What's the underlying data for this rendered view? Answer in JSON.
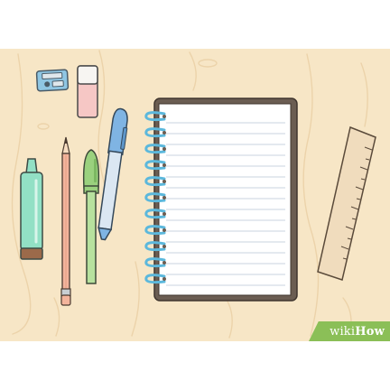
{
  "scene": {
    "description_items": [
      "pencil-sharpener",
      "eraser",
      "highlighter",
      "pencil",
      "marker",
      "pen",
      "spiral-notebook",
      "ruler"
    ],
    "colors": {
      "desk": "#f7e6c6",
      "desk_grain": "#ecd3aa",
      "page_bg": "#ffffff",
      "notebook_cover": "#6b5d52",
      "paper": "#ffffff",
      "paper_line": "#c9d3df",
      "spiral": "#5cb8dc",
      "highlighter": "#92e0c5",
      "pencil": "#f3b49c",
      "marker": "#9ad17e",
      "pen": "#7fb4e3",
      "sharpener": "#8fc6e3",
      "eraser": "#f6c7c5",
      "ruler": "#f0dcbd"
    }
  },
  "watermark": {
    "part1": "wiki",
    "part2": "How",
    "bg": "#8bbf57"
  }
}
